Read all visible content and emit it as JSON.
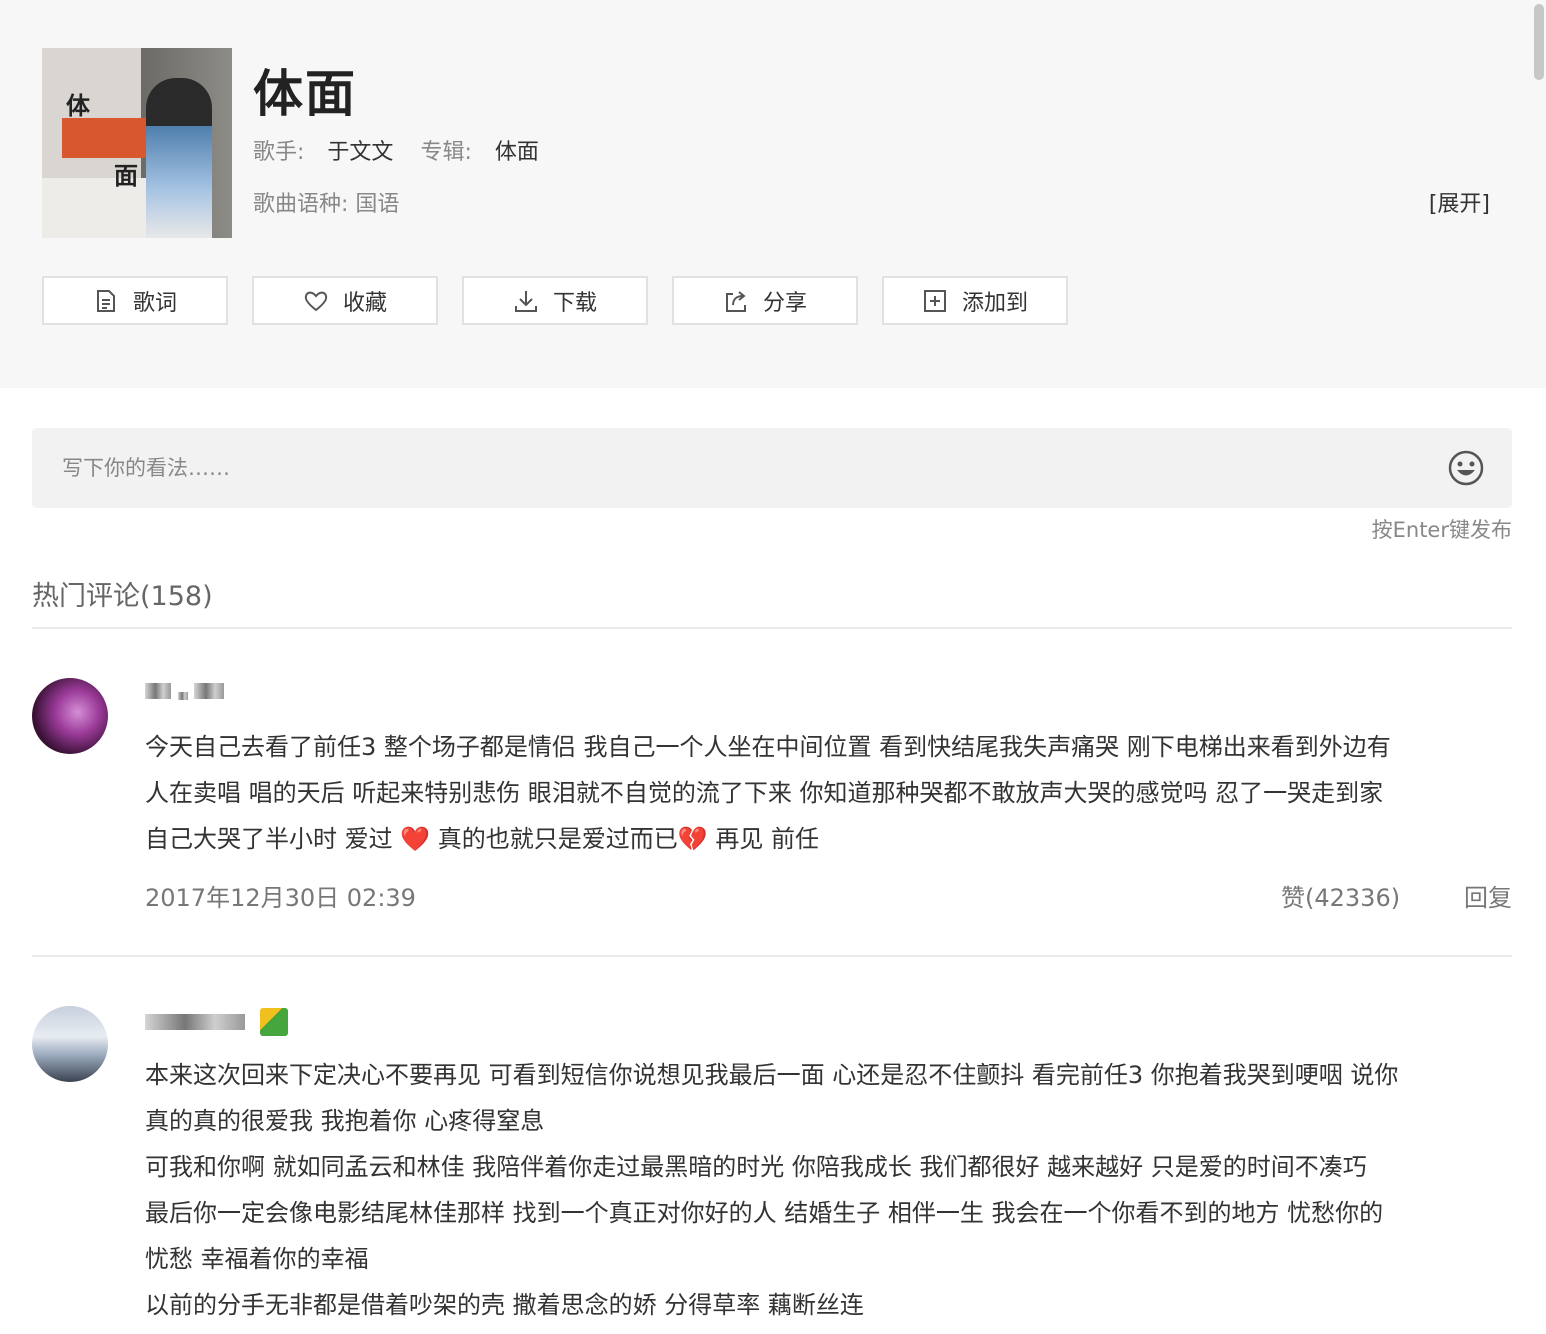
{
  "song": {
    "title": "体面",
    "singer_label": "歌手:",
    "singer": "于文文",
    "album_label": "专辑:",
    "album": "体面",
    "language_label": "歌曲语种:",
    "language": "国语",
    "expand": "[展开]",
    "cover_text_1": "体",
    "cover_text_2": "面"
  },
  "actions": {
    "lyrics": "歌词",
    "favorite": "收藏",
    "download": "下载",
    "share": "分享",
    "add_to": "添加到"
  },
  "comment_input": {
    "placeholder": "写下你的看法……",
    "hint": "按Enter键发布"
  },
  "hot_comments": {
    "title": "热门评论(158)",
    "items": [
      {
        "lines": [
          "今天自己去看了前任3 整个场子都是情侣 我自己一个人坐在中间位置 看到快结尾我失声痛哭 刚下电梯出来看到外边有",
          "人在卖唱 唱的天后 听起来特别悲伤 眼泪就不自觉的流了下来 你知道那种哭都不敢放声大哭的感觉吗 忍了一哭走到家",
          "自己大哭了半小时 爱过"
        ],
        "line3_mid": " 真的也就只是爱过而已",
        "line3_end": " 再见 前任",
        "emoji1": "❤️",
        "emoji2": "💔",
        "date": "2017年12月30日 02:39",
        "likes": "赞(42336)",
        "reply": "回复"
      },
      {
        "lines": [
          "本来这次回来下定决心不要再见 可看到短信你说想见我最后一面 心还是忍不住颤抖 看完前任3 你抱着我哭到哽咽 说你",
          "真的真的很爱我 我抱着你 心疼得窒息",
          "可我和你啊 就如同孟云和林佳 我陪伴着你走过最黑暗的时光 你陪我成长 我们都很好 越来越好 只是爱的时间不凑巧",
          "最后你一定会像电影结尾林佳那样 找到一个真正对你好的人 结婚生子 相伴一生 我会在一个你看不到的地方 忧愁你的",
          "忧愁 幸福着你的幸福",
          "以前的分手无非都是借着吵架的壳 撒着思念的娇 分得草率 藕断丝连"
        ]
      }
    ]
  },
  "colors": {
    "header_bg": "#f7f7f7",
    "input_bg": "#f2f2f2",
    "muted_text": "#777777"
  }
}
